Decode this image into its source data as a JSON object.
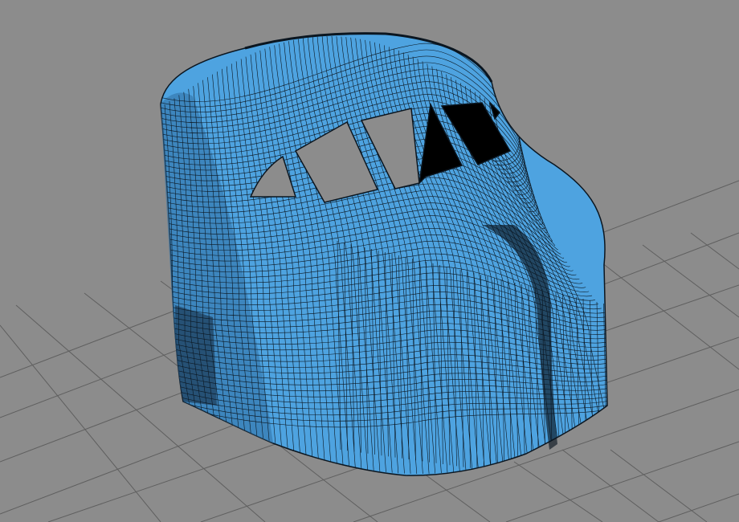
{
  "viewport": {
    "background_color": "#8c8c8c",
    "grid_color": "#5f5f5f"
  },
  "model": {
    "surface_color": "#4ea3e0",
    "shadow_color": "#1f3f5c",
    "wire_color": "#0b1620",
    "window_color": "#000000"
  }
}
